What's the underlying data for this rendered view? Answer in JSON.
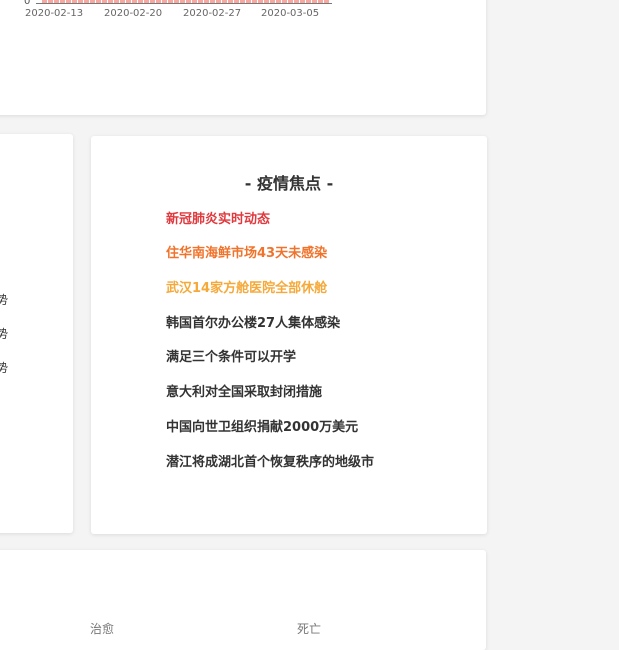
{
  "chart": {
    "y_zero": "0",
    "ticks": [
      "2020-02-13",
      "2020-02-20",
      "2020-02-27",
      "2020-03-05"
    ]
  },
  "trends": [
    {
      "label": "趋势",
      "active": false
    },
    {
      "label": "趋势",
      "active": false
    },
    {
      "label": "趋势",
      "active": false
    },
    {
      "label": "势",
      "active": true
    }
  ],
  "focus": {
    "title": "- 疫情焦点 -",
    "items": [
      {
        "text": "新冠肺炎实时动态",
        "color": "#e0393e"
      },
      {
        "text": "住华南海鲜市场43天未感染",
        "color": "#f0732c"
      },
      {
        "text": "武汉14家方舱医院全部休舱",
        "color": "#f5a93a"
      },
      {
        "text": "韩国首尔办公楼27人集体感染",
        "color": "#333333"
      },
      {
        "text": "满足三个条件可以开学",
        "color": "#333333"
      },
      {
        "text": "意大利对全国采取封闭措施",
        "color": "#333333"
      },
      {
        "text": "中国向世卫组织捐献2000万美元",
        "color": "#333333"
      },
      {
        "text": "潜江将成湖北首个恢复秩序的地级市",
        "color": "#333333"
      }
    ]
  },
  "bottom": {
    "labels": [
      "治愈",
      "死亡"
    ]
  }
}
